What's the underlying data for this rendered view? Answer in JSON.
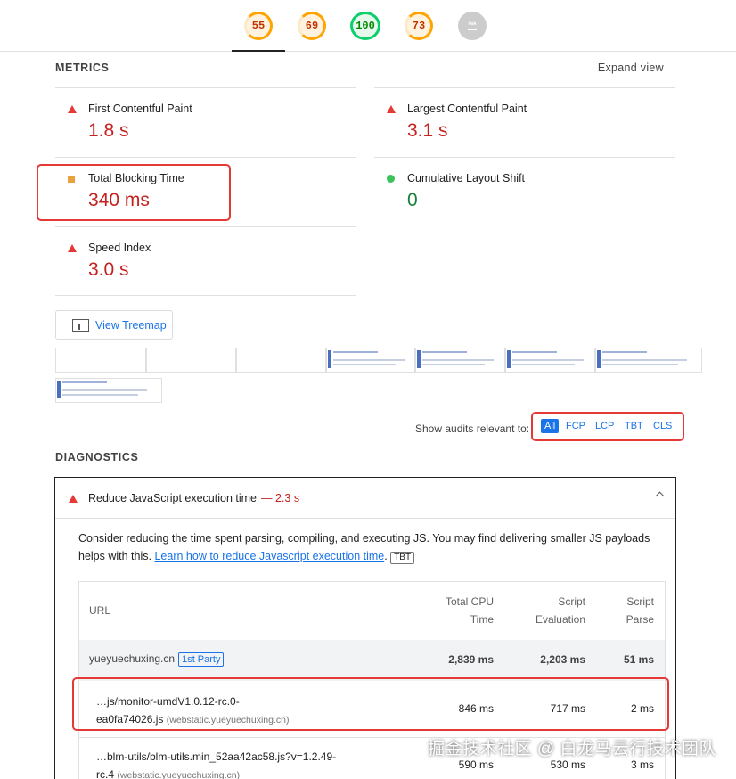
{
  "gauges": [
    {
      "value": "55",
      "tone": "orange"
    },
    {
      "value": "69",
      "tone": "orange"
    },
    {
      "value": "100",
      "tone": "green"
    },
    {
      "value": "73",
      "tone": "orange"
    },
    {
      "value": "PWA",
      "tone": "gray"
    }
  ],
  "metrics": {
    "title": "METRICS",
    "expand": "Expand view",
    "items": [
      {
        "label": "First Contentful Paint",
        "value": "1.8 s",
        "status": "fail"
      },
      {
        "label": "Largest Contentful Paint",
        "value": "3.1 s",
        "status": "fail"
      },
      {
        "label": "Total Blocking Time",
        "value": "340 ms",
        "status": "average"
      },
      {
        "label": "Cumulative Layout Shift",
        "value": "0",
        "status": "pass"
      },
      {
        "label": "Speed Index",
        "value": "3.0 s",
        "status": "fail"
      }
    ]
  },
  "treemap_button": "View Treemap",
  "audits_filter": {
    "label": "Show audits relevant to:",
    "options": [
      "All",
      "FCP",
      "LCP",
      "TBT",
      "CLS"
    ],
    "selected": "All"
  },
  "diagnostics": {
    "title": "DIAGNOSTICS",
    "audit": {
      "title": "Reduce JavaScript execution time",
      "savings": "— 2.3 s",
      "desc_prefix": "Consider reducing the time spent parsing, compiling, and executing JS. You may find delivering smaller JS payloads helps with this.",
      "link": "Learn how to reduce Javascript execution time",
      "tag": "TBT",
      "columns": {
        "url": "URL",
        "cpu_1": "Total CPU",
        "cpu_2": "Time",
        "eval_1": "Script",
        "eval_2": "Evaluation",
        "parse_1": "Script",
        "parse_2": "Parse"
      },
      "party": {
        "name": "yueyuechuxing.cn",
        "badge": "1st Party",
        "cpu": "2,839 ms",
        "eval": "2,203 ms",
        "parse": "51 ms"
      },
      "rows": [
        {
          "url_1": "…js/monitor-umdV1.0.12-rc.0-",
          "url_2": "ea0fa74026.js",
          "host": "(webstatic.yueyuechuxing.cn)",
          "cpu": "846 ms",
          "eval": "717 ms",
          "parse": "2 ms"
        },
        {
          "url_1": "…blm-utils/blm-utils.min_52aa42ac58.js?v=1.2.49-",
          "url_2": "rc.4",
          "host": "(webstatic.yueyuechuxing.cn)",
          "cpu": "590 ms",
          "eval": "530 ms",
          "parse": "3 ms"
        }
      ]
    }
  },
  "watermark": "掘金技术社区 @ 白龙马云行技术团队"
}
